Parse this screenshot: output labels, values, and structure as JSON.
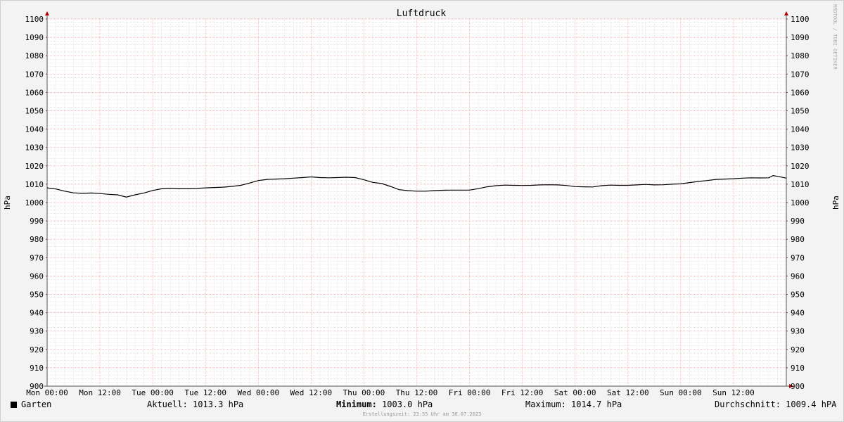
{
  "chart_data": {
    "type": "line",
    "title": "Luftdruck",
    "ylabel": "hPa",
    "ylim": [
      900,
      1100
    ],
    "xlim": [
      0,
      168
    ],
    "yticks": [
      900,
      910,
      920,
      930,
      940,
      950,
      960,
      970,
      980,
      990,
      1000,
      1010,
      1020,
      1030,
      1040,
      1050,
      1060,
      1070,
      1080,
      1090,
      1100
    ],
    "x_ticks": [
      {
        "x": 0,
        "label": "Mon 00:00"
      },
      {
        "x": 12,
        "label": "Mon 12:00"
      },
      {
        "x": 24,
        "label": "Tue 00:00"
      },
      {
        "x": 36,
        "label": "Tue 12:00"
      },
      {
        "x": 48,
        "label": "Wed 00:00"
      },
      {
        "x": 60,
        "label": "Wed 12:00"
      },
      {
        "x": 72,
        "label": "Thu 00:00"
      },
      {
        "x": 84,
        "label": "Thu 12:00"
      },
      {
        "x": 96,
        "label": "Fri 00:00"
      },
      {
        "x": 108,
        "label": "Fri 12:00"
      },
      {
        "x": 120,
        "label": "Sat 00:00"
      },
      {
        "x": 132,
        "label": "Sat 12:00"
      },
      {
        "x": 144,
        "label": "Sun 00:00"
      },
      {
        "x": 156,
        "label": "Sun 12:00"
      }
    ],
    "grid": true,
    "series": [
      {
        "name": "Garten",
        "color": "#000000",
        "x": [
          0,
          2,
          4,
          6,
          8,
          10,
          12,
          14,
          16,
          18,
          20,
          22,
          24,
          26,
          28,
          30,
          32,
          34,
          36,
          38,
          40,
          42,
          44,
          46,
          48,
          50,
          52,
          54,
          56,
          58,
          60,
          62,
          64,
          66,
          68,
          70,
          72,
          74,
          76,
          78,
          80,
          82,
          84,
          86,
          88,
          90,
          92,
          94,
          96,
          98,
          100,
          102,
          104,
          106,
          108,
          110,
          112,
          114,
          116,
          118,
          120,
          122,
          124,
          126,
          128,
          130,
          132,
          134,
          136,
          138,
          140,
          142,
          144,
          146,
          148,
          150,
          152,
          154,
          156,
          158,
          160,
          162,
          164,
          165,
          166,
          168
        ],
        "y": [
          1008.0,
          1007.4,
          1006.2,
          1005.3,
          1005.0,
          1005.2,
          1004.9,
          1004.5,
          1004.2,
          1003.0,
          1004.2,
          1005.2,
          1006.6,
          1007.5,
          1007.8,
          1007.5,
          1007.5,
          1007.7,
          1008.0,
          1008.2,
          1008.4,
          1008.8,
          1009.4,
          1010.6,
          1012.0,
          1012.6,
          1012.8,
          1013.0,
          1013.3,
          1013.6,
          1014.0,
          1013.6,
          1013.5,
          1013.6,
          1013.8,
          1013.6,
          1012.4,
          1011.0,
          1010.4,
          1008.8,
          1007.0,
          1006.5,
          1006.2,
          1006.2,
          1006.5,
          1006.7,
          1006.8,
          1006.8,
          1006.8,
          1007.6,
          1008.6,
          1009.2,
          1009.5,
          1009.4,
          1009.3,
          1009.4,
          1009.6,
          1009.7,
          1009.6,
          1009.3,
          1008.7,
          1008.6,
          1008.5,
          1009.2,
          1009.5,
          1009.4,
          1009.4,
          1009.6,
          1009.9,
          1009.6,
          1009.7,
          1010.0,
          1010.2,
          1010.9,
          1011.5,
          1012.0,
          1012.6,
          1012.8,
          1013.0,
          1013.3,
          1013.5,
          1013.4,
          1013.5,
          1014.7,
          1014.3,
          1013.3
        ]
      }
    ]
  },
  "legend": {
    "series_label": "Garten",
    "current": "Aktuell: 1013.3 hPa",
    "minimum_label": "Minimum:",
    "minimum_value": "1003.0 hPa",
    "maximum": "Maximum: 1014.7 hPa",
    "average": "Durchschnitt: 1009.4 hPA"
  },
  "credit": "Erstellungszeit: 23:55 Uhr am 30.07.2023",
  "side_label": "RRDTOOL / TOBI OETIKER"
}
